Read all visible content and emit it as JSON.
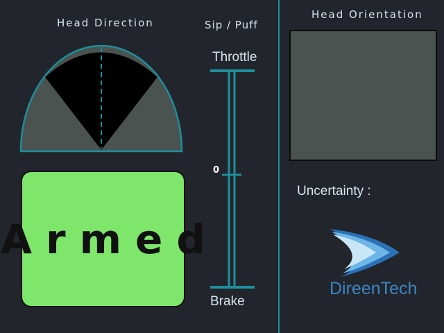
{
  "head_direction": {
    "title": "Head Direction"
  },
  "sip_puff": {
    "title": "Sip / Puff",
    "top_label": "Throttle",
    "zero_label": "0",
    "bottom_label": "Brake"
  },
  "status": {
    "label": "Armed",
    "color": "#7ee66a"
  },
  "head_orientation": {
    "title": "Head Orientation"
  },
  "uncertainty": {
    "label": "Uncertainty :"
  },
  "logo": {
    "text": "DireenTech"
  },
  "colors": {
    "accent": "#1e8f9c",
    "background": "#22252b"
  }
}
